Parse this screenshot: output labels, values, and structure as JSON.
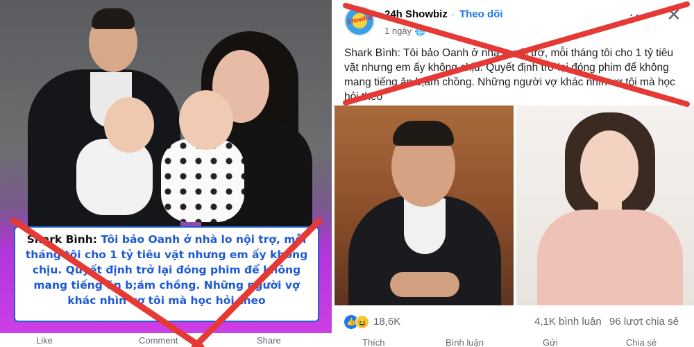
{
  "left": {
    "caption_prefix": "Shark Bình:",
    "caption_text": "Tôi bảo Oanh ở nhà lo nội trợ, mỗi tháng tôi cho 1 tỷ tiêu vặt nhưng em ấy không chịu. Quyết định trở lại đóng phim để không mang tiếng ăn b;ám chồng. Những người vợ khác nhìn vợ tôi mà học hỏi theo",
    "actions": [
      "Like",
      "Comment",
      "Share"
    ]
  },
  "post": {
    "avatar_text": "Showbiz",
    "page_name": "24h Showbiz",
    "dot": "·",
    "follow_label": "Theo dõi",
    "time": "1 ngày",
    "dot2": "·",
    "text": "Shark Bình: Tôi bảo Oanh ở nhà lo nội trợ, mỗi tháng tôi cho 1 tỷ tiêu vặt nhưng em ấy không chịu. Quyết định trở lại đóng phim để không mang tiếng ăn b,ám chồng. Những người vợ khác nhìn vợ tôi mà học hỏi theo",
    "reaction_count": "18,6K",
    "comments": "4,1K bình luận",
    "shares": "96 lượt chia sẻ",
    "actions": [
      "Thích",
      "Bình luận",
      "Gửi",
      "Chia sẻ"
    ]
  },
  "colors": {
    "cross_red": "#e53935",
    "link_blue": "#1877f2",
    "caption_blue": "#1d5ad4",
    "purple": "#cc3fe6"
  },
  "icons": {
    "more": "more-options-icon",
    "close": "close-icon",
    "globe": "globe-icon",
    "like": "like-reaction-icon",
    "haha": "haha-reaction-icon"
  }
}
